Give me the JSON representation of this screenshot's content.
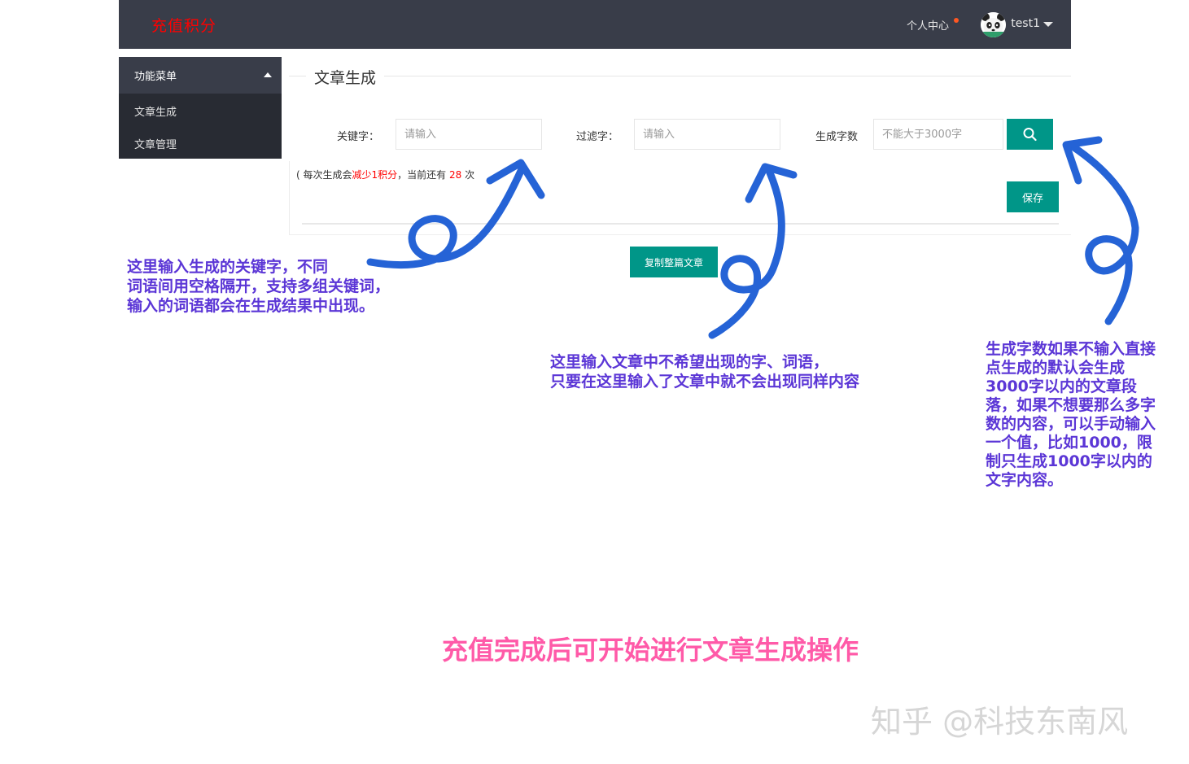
{
  "header": {
    "brand": "充值积分",
    "personal_center": "个人中心",
    "username": "test1"
  },
  "sidebar": {
    "title": "功能菜单",
    "items": [
      {
        "label": "文章生成"
      },
      {
        "label": "文章管理"
      }
    ]
  },
  "main": {
    "title": "文章生成",
    "form": {
      "keyword_label": "关键字：",
      "keyword_placeholder": "请输入",
      "filter_label": "过滤字：",
      "filter_placeholder": "请输入",
      "count_label": "生成字数",
      "count_placeholder": "不能大于3000字"
    },
    "note": {
      "prefix": "( 每次生成会",
      "highlight": "减少1积分",
      "middle": "，当前还有 ",
      "count": "28",
      "suffix": " 次"
    },
    "save_label": "保存",
    "copy_label": "复制整篇文章"
  },
  "annotations": {
    "keyword_lines": [
      "这里输入生成的关键字，不同",
      "词语间用空格隔开，支持多组关键词，",
      "输入的词语都会在生成结果中出现。"
    ],
    "filter_lines": [
      "这里输入文章中不希望出现的字、词语，",
      "只要在这里输入了文章中就不会出现同样内容"
    ],
    "count_lines": [
      "生成字数如果不输入直接",
      "点生成的默认会生成",
      "3000字以内的文章段",
      "落，如果不想要那么多字",
      "数的内容，可以手动输入",
      "一个值，比如1000，限",
      "制只生成1000字以内的",
      "文字内容。"
    ],
    "bottom": "充值完成后可开始进行文章生成操作",
    "watermark": "知乎 @科技东南风"
  },
  "colors": {
    "topbar": "#393d49",
    "brand": "#ff0000",
    "accent": "#009688",
    "annotation_text": "#5b36d6",
    "annotation_arrow": "#2563d6",
    "bottom_text": "#ff5aa8"
  },
  "icons": {
    "search_button": "search-icon",
    "avatar": "panda-avatar"
  }
}
